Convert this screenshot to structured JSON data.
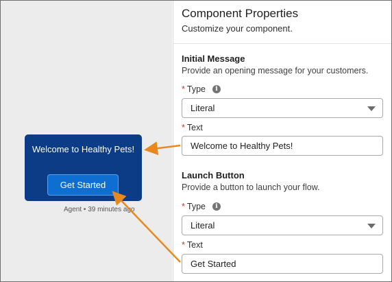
{
  "panel": {
    "title": "Component Properties",
    "subtitle": "Customize your component."
  },
  "initial_message": {
    "title": "Initial Message",
    "description": "Provide an opening message for your customers.",
    "required_marker": "*",
    "type_label": "Type",
    "type_value": "Literal",
    "text_label": "Text",
    "text_value": "Welcome to Healthy Pets!"
  },
  "launch_button": {
    "title": "Launch Button",
    "description": "Provide a button to launch your flow.",
    "required_marker": "*",
    "type_label": "Type",
    "type_value": "Literal",
    "text_label": "Text",
    "text_value": "Get Started"
  },
  "chat_preview": {
    "message": "Welcome to Healthy Pets!",
    "button_label": "Get Started",
    "meta": "Agent • 39 minutes ago"
  },
  "icons": {
    "info": "info-icon",
    "dropdown": "chevron-down-icon"
  },
  "colors": {
    "chat_bg": "#0b3c85",
    "chat_button": "#0f6ed1",
    "required": "#c23934",
    "annotation_arrow": "#e8891f"
  }
}
